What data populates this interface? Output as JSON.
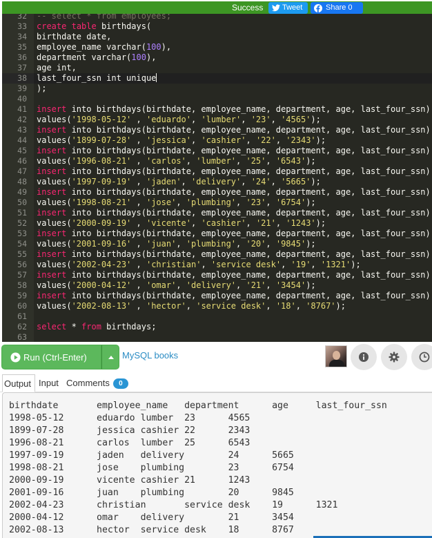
{
  "share_bar": {
    "status": "Success",
    "tweet_label": "Tweet",
    "facebook_label": "Share 0"
  },
  "editor": {
    "active_line": 38,
    "lines": [
      {
        "n": "32",
        "t": [
          [
            "cmt",
            "-- select * from employees;"
          ]
        ]
      },
      {
        "n": "33",
        "t": [
          [
            "kw",
            "create"
          ],
          [
            "pl",
            " "
          ],
          [
            "kw",
            "table"
          ],
          [
            "pl",
            " birthdays("
          ]
        ]
      },
      {
        "n": "34",
        "t": [
          [
            "pl",
            "birthdate date,"
          ]
        ]
      },
      {
        "n": "35",
        "t": [
          [
            "pl",
            "employee_name varchar("
          ],
          [
            "num",
            "100"
          ],
          [
            "pl",
            "),"
          ]
        ]
      },
      {
        "n": "36",
        "t": [
          [
            "pl",
            "department varchar("
          ],
          [
            "num",
            "100"
          ],
          [
            "pl",
            "),"
          ]
        ]
      },
      {
        "n": "37",
        "t": [
          [
            "pl",
            "age int,"
          ]
        ]
      },
      {
        "n": "38",
        "t": [
          [
            "pl",
            "last_four_ssn int unique"
          ]
        ],
        "cursor": true
      },
      {
        "n": "39",
        "t": [
          [
            "pl",
            ");"
          ]
        ]
      },
      {
        "n": "40",
        "t": []
      },
      {
        "n": "41",
        "t": [
          [
            "kw",
            "insert"
          ],
          [
            "pl",
            " into birthdays(birthdate, employee_name, department, age, last_four_ssn)"
          ]
        ]
      },
      {
        "n": "42",
        "t": [
          [
            "pl",
            "values("
          ],
          [
            "str",
            "'1998-05-12'"
          ],
          [
            "pl",
            " , "
          ],
          [
            "str",
            "'eduardo'"
          ],
          [
            "pl",
            ", "
          ],
          [
            "str",
            "'lumber'"
          ],
          [
            "pl",
            ", "
          ],
          [
            "str",
            "'23'"
          ],
          [
            "pl",
            ", "
          ],
          [
            "str",
            "'4565'"
          ],
          [
            "pl",
            ");"
          ]
        ]
      },
      {
        "n": "43",
        "t": [
          [
            "kw",
            "insert"
          ],
          [
            "pl",
            " into birthdays(birthdate, employee_name, department, age, last_four_ssn)"
          ]
        ]
      },
      {
        "n": "44",
        "t": [
          [
            "pl",
            "values("
          ],
          [
            "str",
            "'1899-07-28'"
          ],
          [
            "pl",
            " , "
          ],
          [
            "str",
            "'jessica'"
          ],
          [
            "pl",
            ", "
          ],
          [
            "str",
            "'cashier'"
          ],
          [
            "pl",
            ", "
          ],
          [
            "str",
            "'22'"
          ],
          [
            "pl",
            ", "
          ],
          [
            "str",
            "'2343'"
          ],
          [
            "pl",
            ");"
          ]
        ]
      },
      {
        "n": "45",
        "t": [
          [
            "kw",
            "insert"
          ],
          [
            "pl",
            " into birthdays(birthdate, employee_name, department, age, last_four_ssn)"
          ]
        ]
      },
      {
        "n": "46",
        "t": [
          [
            "pl",
            "values("
          ],
          [
            "str",
            "'1996-08-21'"
          ],
          [
            "pl",
            " , "
          ],
          [
            "str",
            "'carlos'"
          ],
          [
            "pl",
            ", "
          ],
          [
            "str",
            "'lumber'"
          ],
          [
            "pl",
            ", "
          ],
          [
            "str",
            "'25'"
          ],
          [
            "pl",
            ", "
          ],
          [
            "str",
            "'6543'"
          ],
          [
            "pl",
            ");"
          ]
        ]
      },
      {
        "n": "47",
        "t": [
          [
            "kw",
            "insert"
          ],
          [
            "pl",
            " into birthdays(birthdate, employee_name, department, age, last_four_ssn)"
          ]
        ]
      },
      {
        "n": "48",
        "t": [
          [
            "pl",
            "values("
          ],
          [
            "str",
            "'1997-09-19'"
          ],
          [
            "pl",
            " , "
          ],
          [
            "str",
            "'jaden'"
          ],
          [
            "pl",
            ", "
          ],
          [
            "str",
            "'delivery'"
          ],
          [
            "pl",
            ", "
          ],
          [
            "str",
            "'24'"
          ],
          [
            "pl",
            ", "
          ],
          [
            "str",
            "'5665'"
          ],
          [
            "pl",
            ");"
          ]
        ]
      },
      {
        "n": "49",
        "t": [
          [
            "kw",
            "insert"
          ],
          [
            "pl",
            " into birthdays(birthdate, employee_name, department, age, last_four_ssn)"
          ]
        ]
      },
      {
        "n": "50",
        "t": [
          [
            "pl",
            "values("
          ],
          [
            "str",
            "'1998-08-21'"
          ],
          [
            "pl",
            " , "
          ],
          [
            "str",
            "'jose'"
          ],
          [
            "pl",
            ", "
          ],
          [
            "str",
            "'plumbing'"
          ],
          [
            "pl",
            ", "
          ],
          [
            "str",
            "'23'"
          ],
          [
            "pl",
            ", "
          ],
          [
            "str",
            "'6754'"
          ],
          [
            "pl",
            ");"
          ]
        ]
      },
      {
        "n": "51",
        "t": [
          [
            "kw",
            "insert"
          ],
          [
            "pl",
            " into birthdays(birthdate, employee_name, department, age, last_four_ssn)"
          ]
        ]
      },
      {
        "n": "52",
        "t": [
          [
            "pl",
            "values("
          ],
          [
            "str",
            "'2000-09-19'"
          ],
          [
            "pl",
            " , "
          ],
          [
            "str",
            "'vicente'"
          ],
          [
            "pl",
            ", "
          ],
          [
            "str",
            "'cashier'"
          ],
          [
            "pl",
            ", "
          ],
          [
            "str",
            "'21'"
          ],
          [
            "pl",
            ", "
          ],
          [
            "str",
            "'1243'"
          ],
          [
            "pl",
            ");"
          ]
        ]
      },
      {
        "n": "53",
        "t": [
          [
            "kw",
            "insert"
          ],
          [
            "pl",
            " into birthdays(birthdate, employee_name, department, age, last_four_ssn)"
          ]
        ]
      },
      {
        "n": "54",
        "t": [
          [
            "pl",
            "values("
          ],
          [
            "str",
            "'2001-09-16'"
          ],
          [
            "pl",
            " , "
          ],
          [
            "str",
            "'juan'"
          ],
          [
            "pl",
            ", "
          ],
          [
            "str",
            "'plumbing'"
          ],
          [
            "pl",
            ", "
          ],
          [
            "str",
            "'20'"
          ],
          [
            "pl",
            ", "
          ],
          [
            "str",
            "'9845'"
          ],
          [
            "pl",
            ");"
          ]
        ]
      },
      {
        "n": "55",
        "t": [
          [
            "kw",
            "insert"
          ],
          [
            "pl",
            " into birthdays(birthdate, employee_name, department, age, last_four_ssn)"
          ]
        ]
      },
      {
        "n": "56",
        "t": [
          [
            "pl",
            "values("
          ],
          [
            "str",
            "'2002-04-23'"
          ],
          [
            "pl",
            " , "
          ],
          [
            "str",
            "'christian'"
          ],
          [
            "pl",
            ", "
          ],
          [
            "str",
            "'service desk'"
          ],
          [
            "pl",
            ", "
          ],
          [
            "str",
            "'19'"
          ],
          [
            "pl",
            ", "
          ],
          [
            "str",
            "'1321'"
          ],
          [
            "pl",
            ");"
          ]
        ]
      },
      {
        "n": "57",
        "t": [
          [
            "kw",
            "insert"
          ],
          [
            "pl",
            " into birthdays(birthdate, employee_name, department, age, last_four_ssn)"
          ]
        ]
      },
      {
        "n": "58",
        "t": [
          [
            "pl",
            "values("
          ],
          [
            "str",
            "'2000-04-12'"
          ],
          [
            "pl",
            " , "
          ],
          [
            "str",
            "'omar'"
          ],
          [
            "pl",
            ", "
          ],
          [
            "str",
            "'delivery'"
          ],
          [
            "pl",
            ", "
          ],
          [
            "str",
            "'21'"
          ],
          [
            "pl",
            ", "
          ],
          [
            "str",
            "'3454'"
          ],
          [
            "pl",
            ");"
          ]
        ]
      },
      {
        "n": "59",
        "t": [
          [
            "kw",
            "insert"
          ],
          [
            "pl",
            " into birthdays(birthdate, employee_name, department, age, last_four_ssn)"
          ]
        ]
      },
      {
        "n": "60",
        "t": [
          [
            "pl",
            "values("
          ],
          [
            "str",
            "'2002-08-13'"
          ],
          [
            "pl",
            " , "
          ],
          [
            "str",
            "'hector'"
          ],
          [
            "pl",
            ", "
          ],
          [
            "str",
            "'service desk'"
          ],
          [
            "pl",
            ", "
          ],
          [
            "str",
            "'18'"
          ],
          [
            "pl",
            ", "
          ],
          [
            "str",
            "'8767'"
          ],
          [
            "pl",
            ");"
          ]
        ]
      },
      {
        "n": "61",
        "t": []
      },
      {
        "n": "62",
        "t": [
          [
            "kw",
            "select"
          ],
          [
            "pl",
            " * "
          ],
          [
            "kw",
            "from"
          ],
          [
            "pl",
            " birthdays;"
          ]
        ]
      },
      {
        "n": "63",
        "t": []
      }
    ]
  },
  "toolbar": {
    "run_label": "Run (Ctrl-Enter)",
    "tag_link": "MySQL books"
  },
  "tabs": {
    "output": "Output",
    "input": "Input",
    "comments": "Comments",
    "comments_count": "0"
  },
  "output": {
    "lines": [
      "birthdate\temployee_name\tdepartment\tage\tlast_four_ssn",
      "1998-05-12\teduardo\tlumber\t23\t4565",
      "1899-07-28\tjessica\tcashier\t22\t2343",
      "1996-08-21\tcarlos\tlumber\t25\t6543",
      "1997-09-19\tjaden\tdelivery\t24\t5665",
      "1998-08-21\tjose\tplumbing\t23\t6754",
      "2000-09-19\tvicente\tcashier\t21\t1243",
      "2001-09-16\tjuan\tplumbing\t20\t9845",
      "2002-04-23\tchristian\tservice desk\t19\t1321",
      "2000-04-12\tomar\tdelivery\t21\t3454",
      "2002-08-13\thector\tservice desk\t18\t8767"
    ]
  },
  "colors": {
    "success_green": "#3d9624",
    "run_green": "#5cb85c",
    "link_blue": "#2a8cc4",
    "badge_blue": "#2a95d4",
    "editor_bg": "#272822"
  },
  "icons": [
    "twitter-icon",
    "facebook-icon",
    "play-circle-icon",
    "caret-up-icon",
    "info-icon",
    "gear-icon",
    "clock-icon"
  ]
}
